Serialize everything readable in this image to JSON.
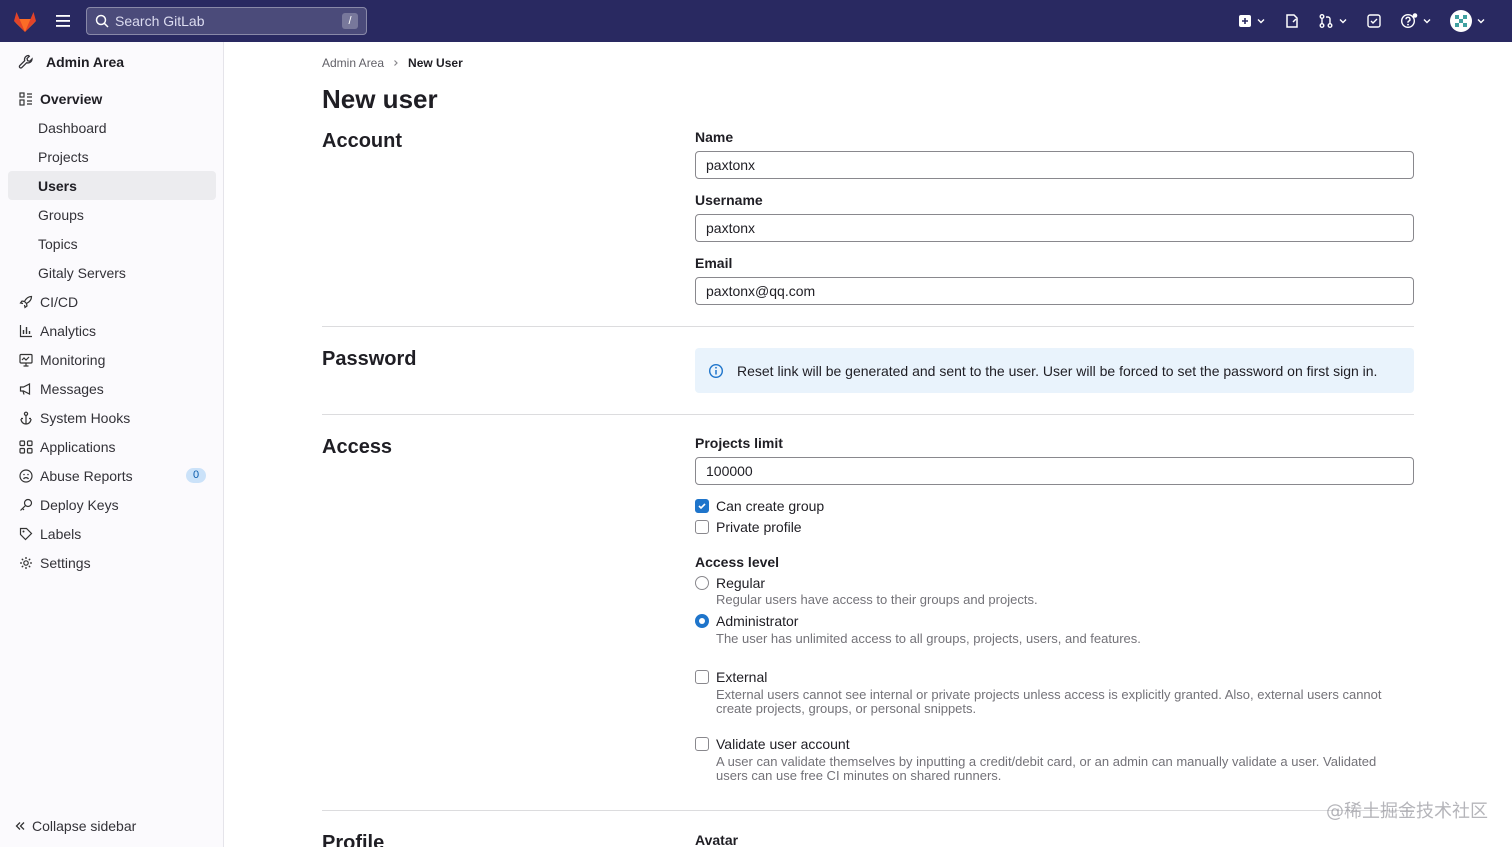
{
  "topbar": {
    "search_placeholder": "Search GitLab",
    "search_shortcut": "/"
  },
  "sidebar": {
    "header": "Admin Area",
    "items": [
      {
        "label": "Overview",
        "icon": "overview-icon"
      },
      {
        "label": "Dashboard"
      },
      {
        "label": "Projects"
      },
      {
        "label": "Users"
      },
      {
        "label": "Groups"
      },
      {
        "label": "Topics"
      },
      {
        "label": "Gitaly Servers"
      },
      {
        "label": "CI/CD",
        "icon": "rocket-icon"
      },
      {
        "label": "Analytics",
        "icon": "chart-icon"
      },
      {
        "label": "Monitoring",
        "icon": "monitor-icon"
      },
      {
        "label": "Messages",
        "icon": "bullhorn-icon"
      },
      {
        "label": "System Hooks",
        "icon": "hook-icon"
      },
      {
        "label": "Applications",
        "icon": "apps-icon"
      },
      {
        "label": "Abuse Reports",
        "icon": "abuse-icon",
        "badge": "0"
      },
      {
        "label": "Deploy Keys",
        "icon": "key-icon"
      },
      {
        "label": "Labels",
        "icon": "label-icon"
      },
      {
        "label": "Settings",
        "icon": "gear-icon"
      }
    ],
    "collapse_label": "Collapse sidebar"
  },
  "breadcrumb": {
    "root": "Admin Area",
    "current": "New User"
  },
  "page_title": "New user",
  "account": {
    "title": "Account",
    "name_label": "Name",
    "name_value": "paxtonx",
    "username_label": "Username",
    "username_value": "paxtonx",
    "email_label": "Email",
    "email_value": "paxtonx@qq.com"
  },
  "password": {
    "title": "Password",
    "alert_text": "Reset link will be generated and sent to the user. User will be forced to set the password on first sign in."
  },
  "access": {
    "title": "Access",
    "projects_limit_label": "Projects limit",
    "projects_limit_value": "100000",
    "can_create_group_label": "Can create group",
    "can_create_group_checked": true,
    "private_profile_label": "Private profile",
    "private_profile_checked": false,
    "access_level_label": "Access level",
    "regular_label": "Regular",
    "regular_help": "Regular users have access to their groups and projects.",
    "admin_label": "Administrator",
    "admin_help": "The user has unlimited access to all groups, projects, users, and features.",
    "selected_level": "Administrator",
    "external_label": "External",
    "external_help": "External users cannot see internal or private projects unless access is explicitly granted. Also, external users cannot create projects, groups, or personal snippets.",
    "validate_label": "Validate user account",
    "validate_help": "A user can validate themselves by inputting a credit/debit card, or an admin can manually validate a user. Validated users can use free CI minutes on shared runners."
  },
  "profile": {
    "title": "Profile",
    "avatar_label": "Avatar"
  },
  "watermark": "@稀土掘金技术社区",
  "colors": {
    "topbar": "#292961",
    "accent": "#1f75cb",
    "alert_bg": "#e9f3fc"
  }
}
